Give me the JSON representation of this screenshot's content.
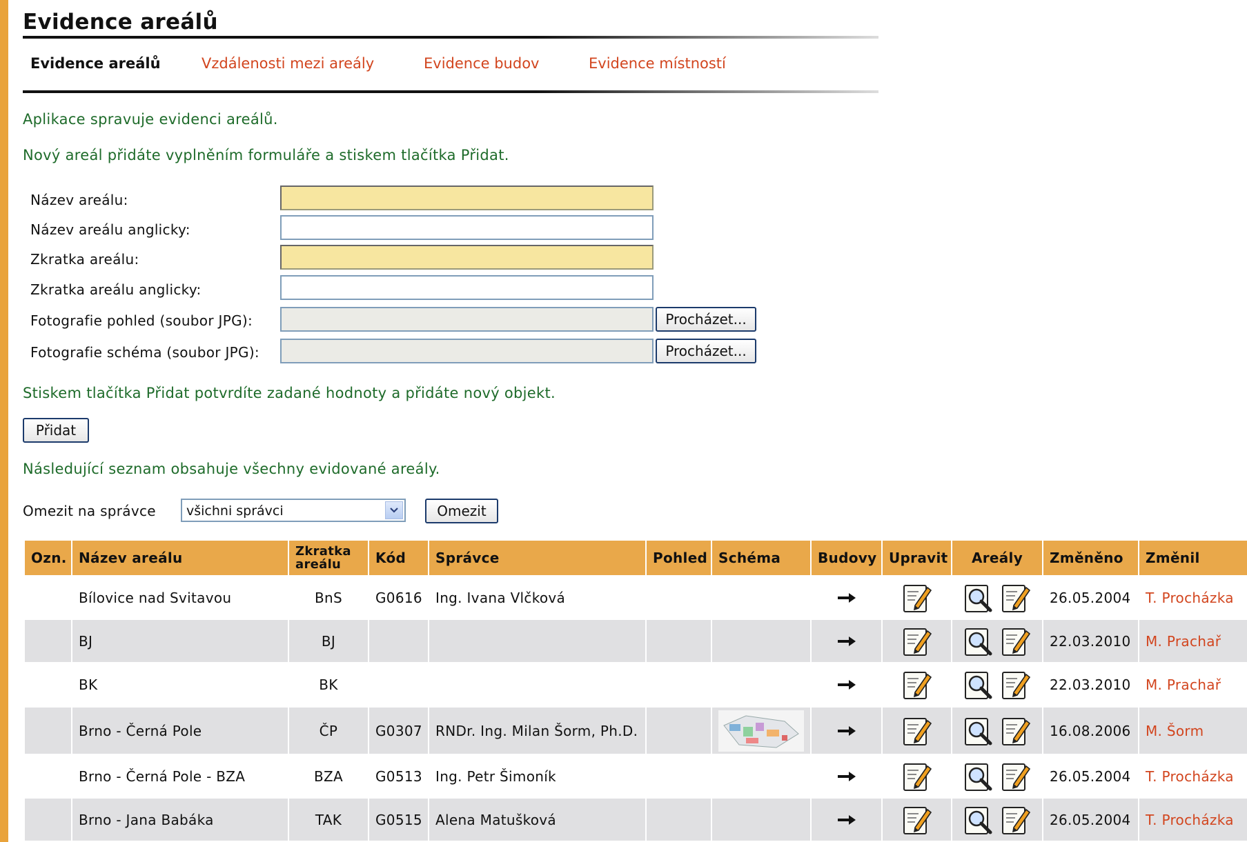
{
  "page": {
    "title": "Evidence areálů"
  },
  "tabs": [
    {
      "label": "Evidence areálů",
      "active": true
    },
    {
      "label": "Vzdálenosti mezi areály",
      "active": false
    },
    {
      "label": "Evidence budov",
      "active": false
    },
    {
      "label": "Evidence místností",
      "active": false
    }
  ],
  "info": {
    "intro": "Aplikace spravuje evidenci areálů.",
    "add_hint": "Nový areál přidáte vyplněním formuláře a stiskem tlačítka Přidat.",
    "confirm_hint": "Stiskem tlačítka Přidat potvrdíte zadané hodnoty a přidáte nový objekt.",
    "list_hint": "Následující seznam obsahuje všechny evidované areály."
  },
  "form": {
    "name_label": "Název areálu:",
    "name_en_label": "Název areálu anglicky:",
    "abbr_label": "Zkratka areálu:",
    "abbr_en_label": "Zkratka areálu anglicky:",
    "photo_view_label": "Fotografie pohled (soubor JPG):",
    "photo_scheme_label": "Fotografie schéma (soubor JPG):",
    "browse_label": "Procházet...",
    "add_button": "Přidat",
    "name_value": "",
    "name_en_value": "",
    "abbr_value": "",
    "abbr_en_value": ""
  },
  "filter": {
    "label": "Omezit na správce",
    "selected": "všichni správci",
    "button": "Omezit"
  },
  "table": {
    "headers": {
      "ozn": "Ozn.",
      "name": "Název areálu",
      "abbr": "Zkratka areálu",
      "code": "Kód",
      "admin": "Správce",
      "view": "Pohled",
      "scheme": "Schéma",
      "buildings": "Budovy",
      "edit": "Upravit",
      "areas": "Areály",
      "changed": "Změněno",
      "changed_by": "Změnil"
    },
    "rows": [
      {
        "name": "Bílovice nad Svitavou",
        "abbr": "BnS",
        "code": "G0616",
        "admin": "Ing. Ivana Vlčková",
        "has_scheme": false,
        "changed": "26.05.2004",
        "changed_by": "T. Procházka"
      },
      {
        "name": "BJ",
        "abbr": "BJ",
        "code": "",
        "admin": "",
        "has_scheme": false,
        "changed": "22.03.2010",
        "changed_by": "M. Prachař"
      },
      {
        "name": "BK",
        "abbr": "BK",
        "code": "",
        "admin": "",
        "has_scheme": false,
        "changed": "22.03.2010",
        "changed_by": "M. Prachař"
      },
      {
        "name": "Brno - Černá Pole",
        "abbr": "ČP",
        "code": "G0307",
        "admin": "RNDr. Ing. Milan Šorm, Ph.D.",
        "has_scheme": true,
        "changed": "16.08.2006",
        "changed_by": "M. Šorm"
      },
      {
        "name": "Brno - Černá Pole - BZA",
        "abbr": "BZA",
        "code": "G0513",
        "admin": "Ing. Petr Šimoník",
        "has_scheme": false,
        "changed": "26.05.2004",
        "changed_by": "T. Procházka"
      },
      {
        "name": "Brno - Jana Babáka",
        "abbr": "TAK",
        "code": "G0515",
        "admin": "Alena Matušková",
        "has_scheme": false,
        "changed": "26.05.2004",
        "changed_by": "T. Procházka"
      }
    ]
  },
  "icons": {
    "buildings": "arrow-right-icon",
    "edit": "edit-pencil-icon",
    "area_detail": "magnifier-icon",
    "area_edit": "edit-pencil-icon",
    "dropdown": "chevron-down-icon"
  },
  "colors": {
    "accent": "#e9a84a",
    "link": "#d2451e",
    "info_text": "#1e6b2a",
    "required_field": "#f7e6a0",
    "row_alt": "#e0e0e2"
  }
}
